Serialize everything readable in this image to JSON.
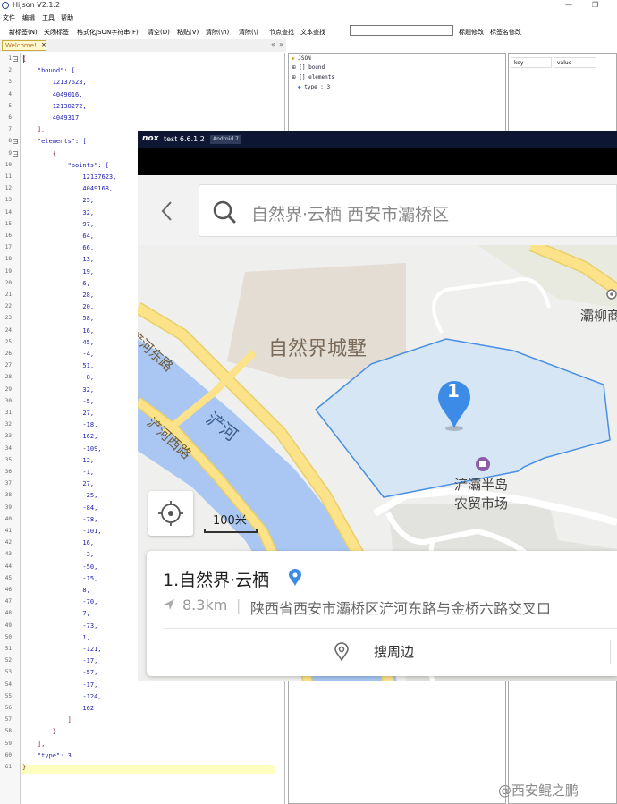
{
  "app": {
    "title": "HiJson V2.1.2",
    "window_buttons": [
      "—",
      "❐"
    ],
    "menu": [
      "文件",
      "编辑",
      "工具",
      "帮助"
    ],
    "toolbar": [
      "新标签(N)",
      "关闭标签",
      "格式化JSON字符串(F)",
      "清空(D)",
      "粘贴(V)",
      "清除(\\n)",
      "清除(\\)",
      "节点查找",
      "文本查找"
    ],
    "toolbar_right": [
      "标题修改",
      "标签名修改"
    ],
    "search_value": "",
    "tab_label": "Welcome!",
    "tab_close": "×",
    "tab_right_icons": [
      "«",
      "»"
    ]
  },
  "editor": {
    "line_numbers": [
      "1",
      "2",
      "3",
      "4",
      "5",
      "6",
      "7",
      "8",
      "9",
      "10",
      "11",
      "12",
      "13",
      "14",
      "15",
      "16",
      "17",
      "18",
      "19",
      "20",
      "21",
      "22",
      "23",
      "24",
      "25",
      "26",
      "27",
      "28",
      "29",
      "30",
      "31",
      "32",
      "33",
      "34",
      "35",
      "36",
      "37",
      "38",
      "39",
      "40",
      "41",
      "42",
      "43",
      "44",
      "45",
      "46",
      "47",
      "48",
      "49",
      "50",
      "51",
      "52",
      "53",
      "54",
      "55",
      "56",
      "57",
      "58",
      "59",
      "60",
      "61"
    ],
    "lines": [
      "{",
      "    \"bound\": [",
      "        12137623,",
      "        4049016,",
      "        12138272,",
      "        4049317",
      "    ],",
      "    \"elements\": [",
      "        {",
      "            \"points\": [",
      "                12137623,",
      "                4049168,",
      "                25,",
      "                32,",
      "                97,",
      "                64,",
      "                66,",
      "                13,",
      "                19,",
      "                6,",
      "                28,",
      "                20,",
      "                58,",
      "                16,",
      "                45,",
      "                -4,",
      "                51,",
      "                -8,",
      "                32,",
      "                -5,",
      "                27,",
      "                -18,",
      "                162,",
      "                -109,",
      "                12,",
      "                -1,",
      "                27,",
      "                -25,",
      "                -84,",
      "                -78,",
      "                -101,",
      "                16,",
      "                -3,",
      "                -50,",
      "                -15,",
      "                8,",
      "                -70,",
      "                7,",
      "                -73,",
      "                1,",
      "                -121,",
      "                -17,",
      "                -57,",
      "                -17,",
      "                -124,",
      "                162",
      "            ]",
      "        }",
      "    ],",
      "    \"type\": 3",
      "}"
    ]
  },
  "tree": {
    "items": [
      "JSON",
      "[] bound",
      "[] elements",
      "type : 3"
    ]
  },
  "kv_panel": {
    "key_header": "key",
    "value_header": "value"
  },
  "nox": {
    "logo": "nox",
    "name": "test 6.6.1.2",
    "badge": "Android 7"
  },
  "map_app": {
    "search_text": "自然界·云栖 西安市灞桥区",
    "labels": {
      "community": "自然界城墅",
      "road1": "浐河东路",
      "road2": "浐河西路",
      "river": "浐河",
      "market_line1": "浐灞半岛",
      "market_line2": "农贸市场",
      "edge_place": "灞柳商"
    },
    "marker_number": "1",
    "scale": "100米",
    "poi": {
      "title": "1.自然界·云栖",
      "distance": "8.3km",
      "separator": "|",
      "address": "陕西省西安市灞桥区浐河东路与金桥六路交叉口"
    },
    "nearby_label": "搜周边",
    "colors": {
      "polygon_fill": "#d6e6f5",
      "polygon_stroke": "#4a90e2",
      "marker": "#3c8ce7",
      "road": "#fce38a",
      "river": "#a9c7f2"
    }
  },
  "watermark": "@西安鲲之鹏"
}
